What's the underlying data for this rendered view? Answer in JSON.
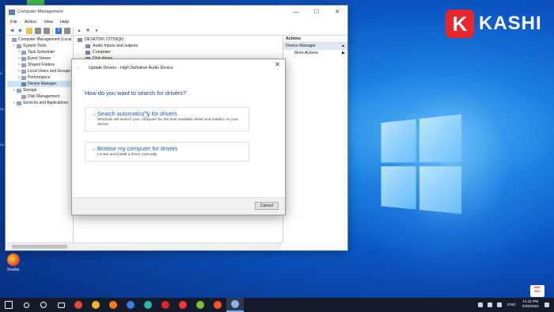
{
  "desktop": {
    "firefox_label": "Firefox",
    "left_strip": [
      "C",
      "Co",
      "Co"
    ],
    "brand_letter": "K",
    "brand_text": "KASHI",
    "corner_badge": [
      "BÀN",
      "ĐẦY"
    ]
  },
  "window": {
    "title": "Computer Management",
    "minimize": "—",
    "maximize": "☐",
    "close": "✕",
    "menu": [
      "File",
      "Action",
      "View",
      "Help"
    ]
  },
  "tree": [
    {
      "label": "Computer Management (Local",
      "indent": 0,
      "twisty": ""
    },
    {
      "label": "System Tools",
      "indent": 1,
      "twisty": "v"
    },
    {
      "label": "Task Scheduler",
      "indent": 2,
      "twisty": ">"
    },
    {
      "label": "Event Viewer",
      "indent": 2,
      "twisty": ">"
    },
    {
      "label": "Shared Folders",
      "indent": 2,
      "twisty": ">"
    },
    {
      "label": "Local Users and Groups",
      "indent": 2,
      "twisty": ">"
    },
    {
      "label": "Performance",
      "indent": 2,
      "twisty": ">"
    },
    {
      "label": "Device Manager",
      "indent": 2,
      "twisty": "",
      "selected": true
    },
    {
      "label": "Storage",
      "indent": 1,
      "twisty": "v"
    },
    {
      "label": "Disk Management",
      "indent": 2,
      "twisty": ""
    },
    {
      "label": "Services and Applications",
      "indent": 1,
      "twisty": ">"
    }
  ],
  "devices": {
    "root": "DESKTOP-72T59QN",
    "items": [
      "Audio inputs and outputs",
      "Computer",
      "Disk drives"
    ]
  },
  "actions": {
    "header": "Actions",
    "section": "Device Manager",
    "section_arrow": "▲",
    "more": "More Actions",
    "more_arrow": "▶"
  },
  "dialog": {
    "back": "←",
    "title": "Update Drivers - High Definition Audio Device",
    "close": "✕",
    "question": "How do you want to search for drivers?",
    "options": [
      {
        "arrow": "→",
        "title": "Search automatically for drivers",
        "desc": "Windows will search your computer for the best available driver and install it on your device."
      },
      {
        "arrow": "→",
        "title": "Browse my computer for drivers",
        "desc": "Locate and install a driver manually."
      }
    ],
    "cancel": "Cancel"
  },
  "taskbar": {
    "lang": "ENG",
    "time": "11:11 PM",
    "date": "3/20/2021",
    "icons": [
      "start-icon",
      "search-icon",
      "task-view-icon",
      "widgets-icon",
      "app-red-icon",
      "chrome-icon",
      "firefox-icon",
      "firefox-dev-icon",
      "edge-icon",
      "opera-icon",
      "vivaldi-icon",
      "app-green-icon",
      "brave-icon",
      "device-manager-icon"
    ],
    "colors": {
      "app-red-icon": "#e0493a",
      "chrome-icon": "#f2b531",
      "firefox-icon": "#ff7a1a",
      "firefox-dev-icon": "#3c7ae6",
      "edge-icon": "#2db8a5",
      "opera-icon": "#e02330",
      "vivaldi-icon": "#ef3939",
      "app-green-icon": "#7fbf3b",
      "brave-icon": "#fb542b",
      "device-manager-icon": "#8fb2e8"
    }
  }
}
